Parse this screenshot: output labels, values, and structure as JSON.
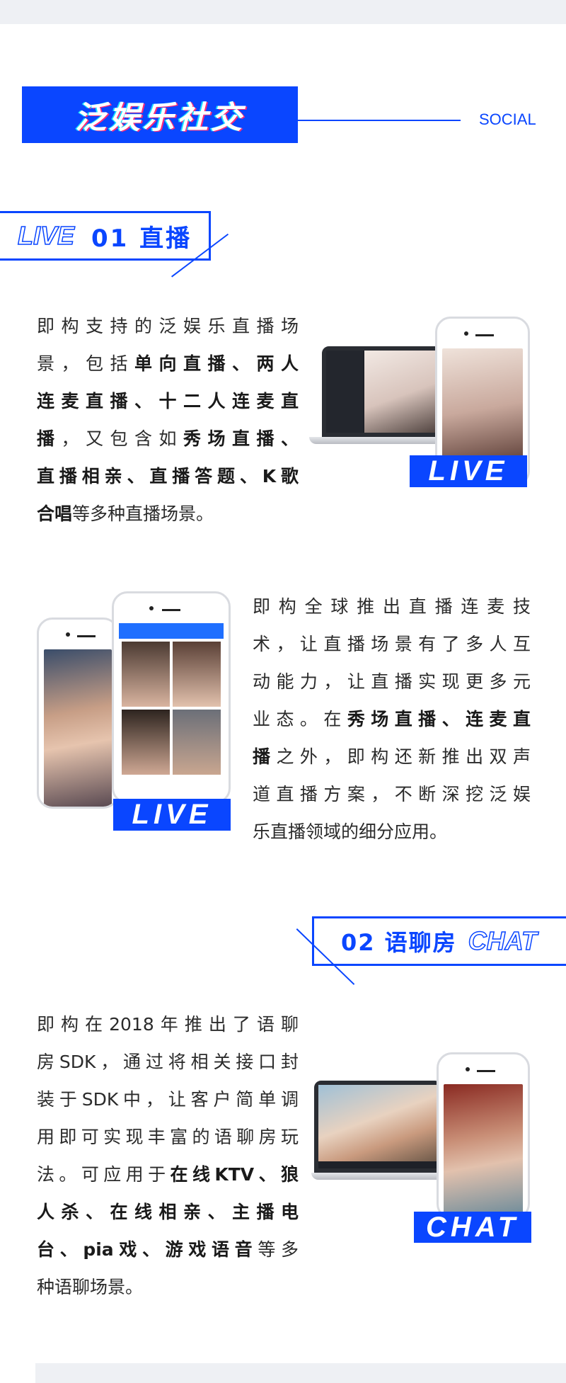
{
  "header": {
    "title": "泛娱乐社交",
    "subtitle": "SOCIAL"
  },
  "colors": {
    "accent": "#0a46ff",
    "text": "#2b2b2b",
    "band": "#eef0f4"
  },
  "section1": {
    "tag": "LIVE",
    "title": "01 直播"
  },
  "section2": {
    "tag": "CHAT",
    "title": "02 语聊房"
  },
  "para1": [
    [
      {
        "t": "即构支持的泛娱乐直播场"
      }
    ],
    [
      {
        "t": "景，包括"
      },
      {
        "t": "单向直播、两人",
        "b": true
      }
    ],
    [
      {
        "t": "连麦直播、十二人连麦直",
        "b": true
      }
    ],
    [
      {
        "t": "播",
        "b": true
      },
      {
        "t": "，又包含如"
      },
      {
        "t": "秀场直播、",
        "b": true
      }
    ],
    [
      {
        "t": "直播相亲、直播答题、K歌",
        "b": true
      }
    ],
    [
      {
        "t": "合唱",
        "b": true
      },
      {
        "t": "等多种直播场景。"
      }
    ]
  ],
  "para2": [
    [
      {
        "t": "即构全球推出直播连麦技"
      }
    ],
    [
      {
        "t": "术，让直播场景有了多人互"
      }
    ],
    [
      {
        "t": "动能力，让直播实现更多元"
      }
    ],
    [
      {
        "t": "业态。在"
      },
      {
        "t": "秀场直播、连麦直",
        "b": true
      }
    ],
    [
      {
        "t": "播",
        "b": true
      },
      {
        "t": "之外，即构还新推出双声"
      }
    ],
    [
      {
        "t": "道直播方案，不断深挖泛娱"
      }
    ],
    [
      {
        "t": "乐直播领域的细分应用。"
      }
    ]
  ],
  "para3": [
    [
      {
        "t": "即构在2018年推出了语聊"
      }
    ],
    [
      {
        "t": "房SDK，通过将相关接口封"
      }
    ],
    [
      {
        "t": "装于SDK中，让客户简单调"
      }
    ],
    [
      {
        "t": "用即可实现丰富的语聊房玩"
      }
    ],
    [
      {
        "t": "法。可应用于"
      },
      {
        "t": "在线KTV、狼",
        "b": true
      }
    ],
    [
      {
        "t": "人杀、在线相亲、主播电",
        "b": true
      }
    ],
    [
      {
        "t": "台、pia戏、游戏语音",
        "b": true
      },
      {
        "t": "等多"
      }
    ],
    [
      {
        "t": "种语聊场景。"
      }
    ]
  ],
  "images": {
    "live1_badge": "LIVE",
    "live2_badge": "LIVE",
    "chat_badge": "CHAT"
  }
}
